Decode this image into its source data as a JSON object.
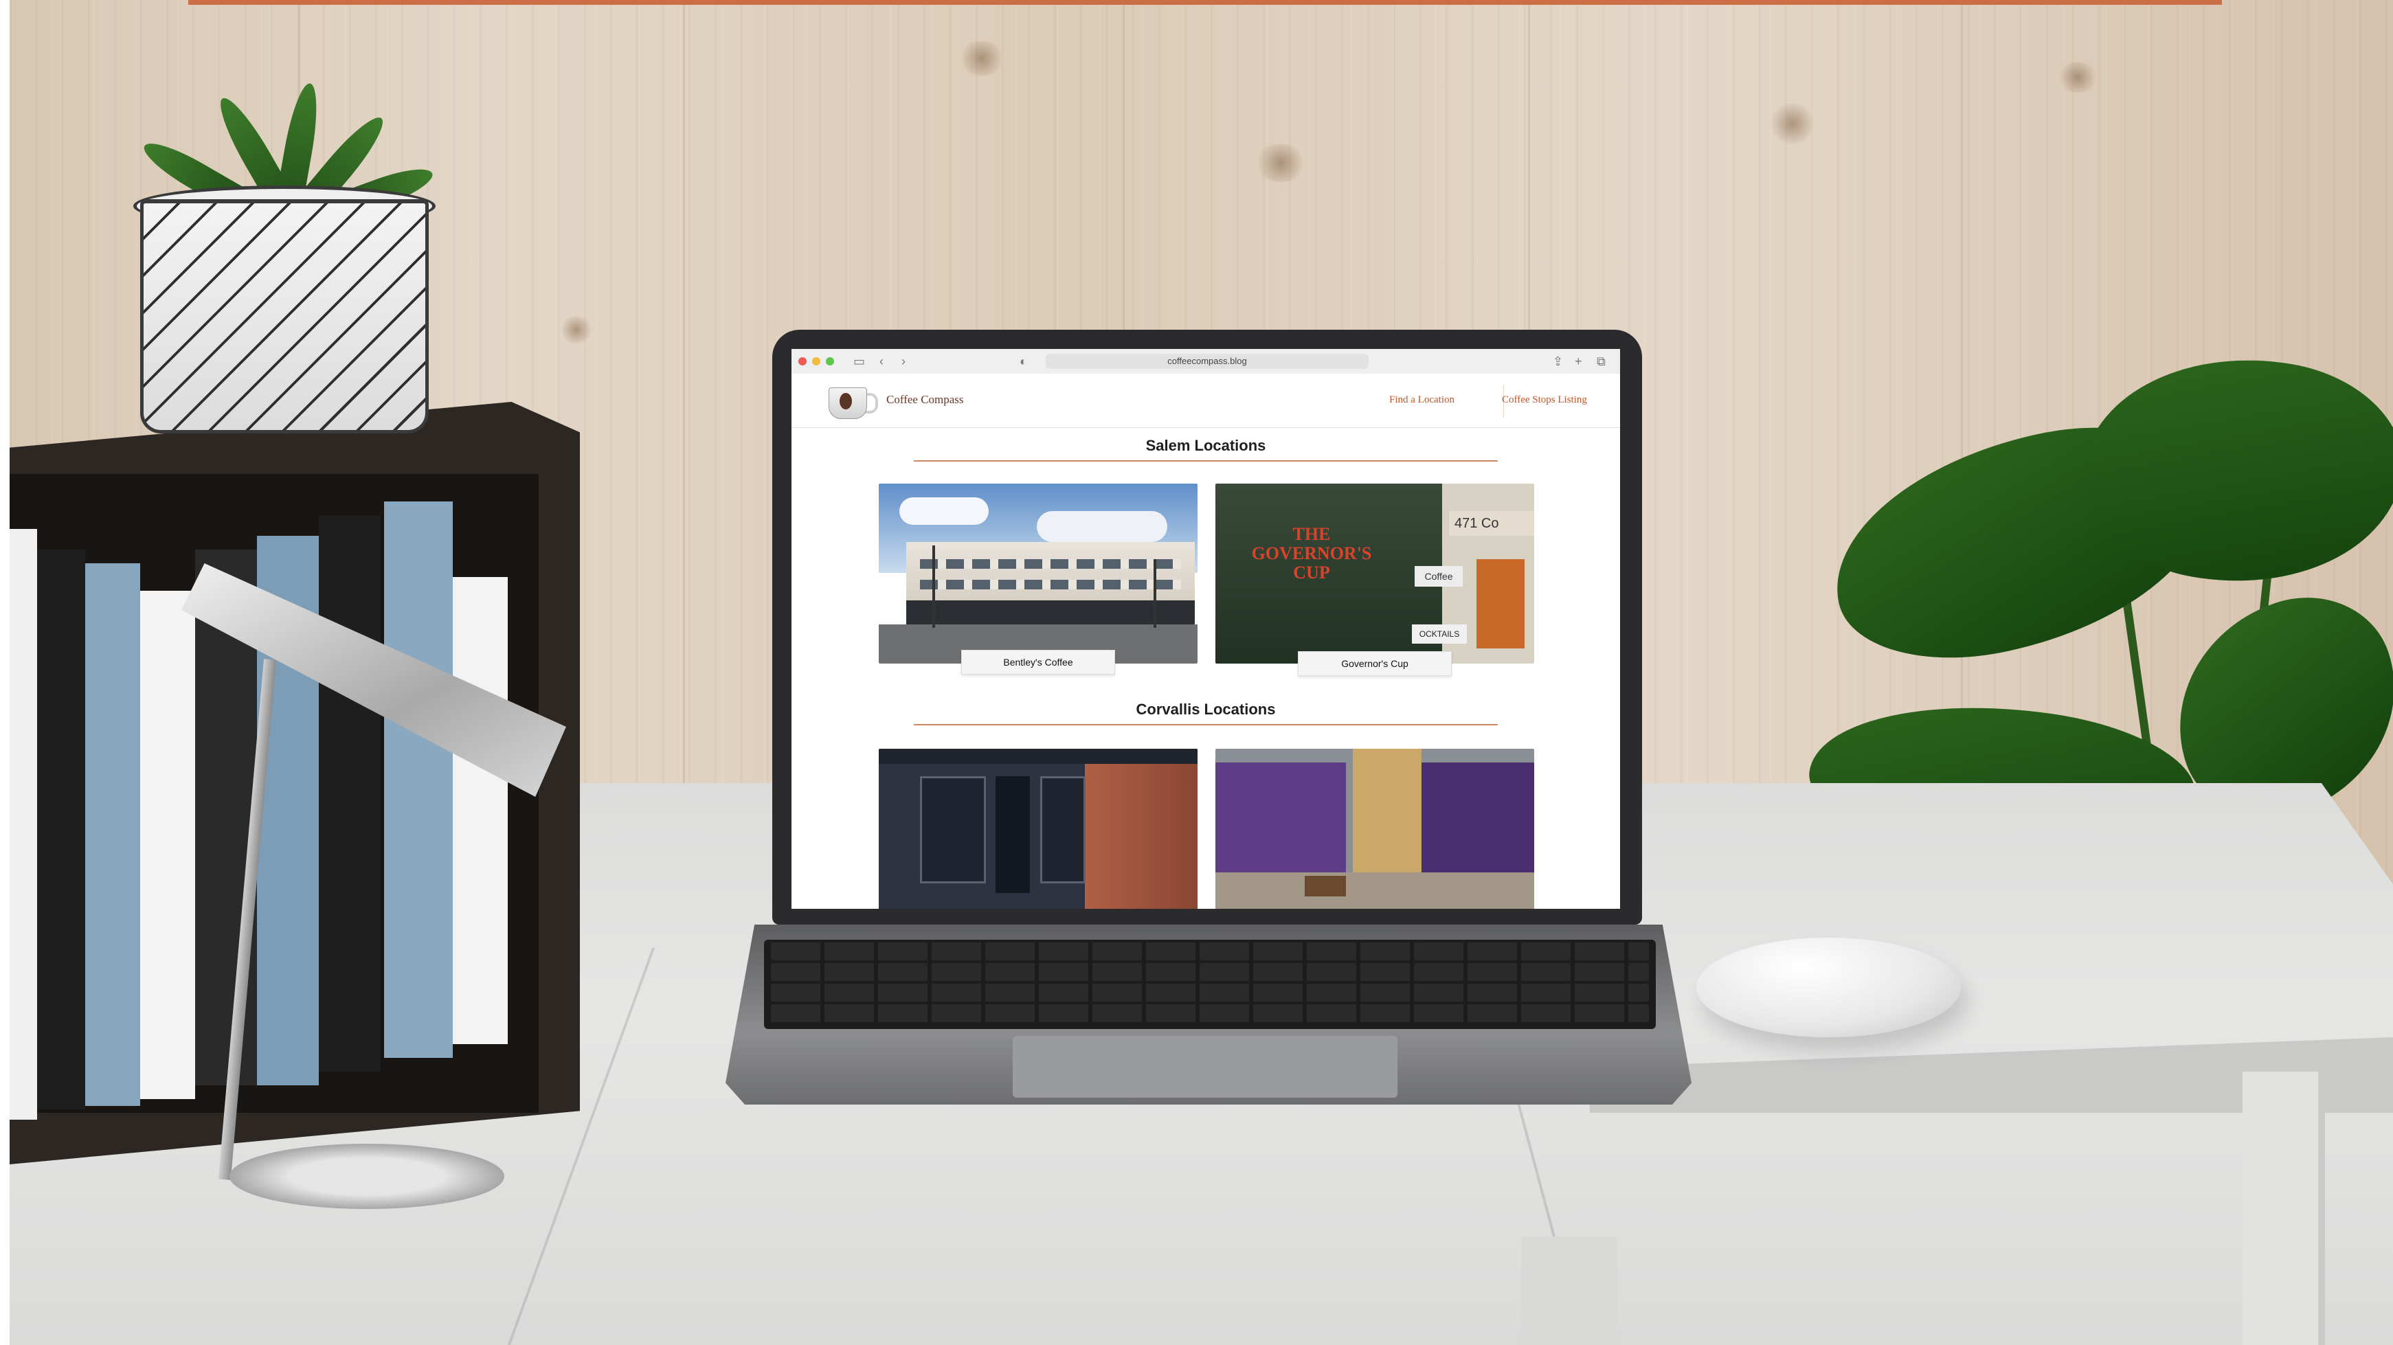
{
  "browser": {
    "url": "coffeecompass.blog"
  },
  "site": {
    "brand": "Coffee Compass",
    "nav": [
      "Find a Location",
      "Coffee Stops Listing"
    ]
  },
  "sections": [
    {
      "title": "Salem Locations",
      "shops": [
        {
          "name": "Bentley's Coffee"
        },
        {
          "name": "Governor's Cup"
        }
      ]
    },
    {
      "title": "Corvallis Locations",
      "shops": []
    }
  ],
  "photo_text": {
    "governors_sign": "THE GOVERNOR'S CUP",
    "address_sign": "471 Co",
    "coffee_sign": "Coffee",
    "cocktails_sign": "OCKTAILS"
  },
  "colors": {
    "accent": "#c2562a",
    "brand_text": "#6b3a26",
    "rule": "#c98a63",
    "top_strip": "#cc6e45"
  }
}
